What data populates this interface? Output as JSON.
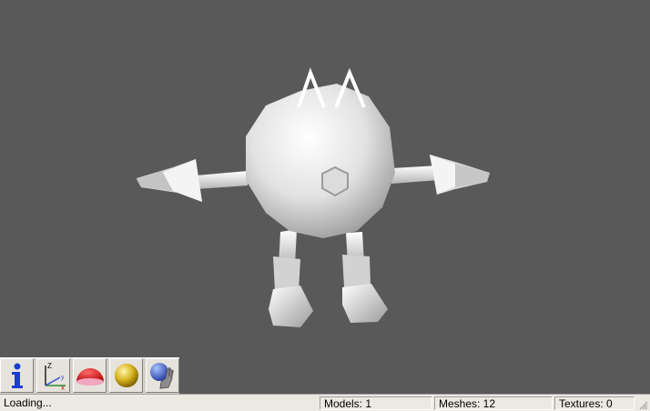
{
  "toolbar": {
    "buttons": [
      {
        "name": "info-button",
        "icon": "info-icon"
      },
      {
        "name": "axes-button",
        "icon": "axes-icon"
      },
      {
        "name": "hemisphere-button",
        "icon": "red-hemisphere-icon"
      },
      {
        "name": "material-sphere-button",
        "icon": "gold-sphere-icon"
      },
      {
        "name": "interact-button",
        "icon": "globe-hand-icon"
      }
    ],
    "axes_labels": {
      "z": "Z",
      "y": "y",
      "x": "x"
    }
  },
  "statusbar": {
    "message": "Loading...",
    "models": "Models: 1",
    "meshes": "Meshes: 12",
    "textures": "Textures: 0"
  },
  "colors": {
    "viewport_bg": "#595959",
    "model": "#e6e6e6",
    "statusbar_bg": "#ece9e2"
  }
}
